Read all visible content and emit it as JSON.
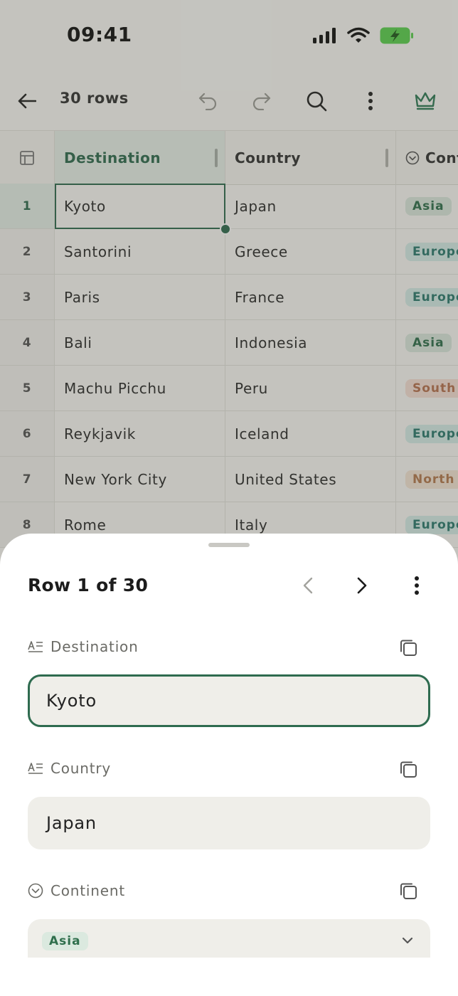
{
  "status_bar": {
    "time": "09:41"
  },
  "toolbar": {
    "title": "30 rows"
  },
  "grid": {
    "columns": [
      "Destination",
      "Country",
      "Cont"
    ],
    "rows": [
      {
        "n": "1",
        "destination": "Kyoto",
        "country": "Japan",
        "continent": "Asia",
        "continent_color": "asia"
      },
      {
        "n": "2",
        "destination": "Santorini",
        "country": "Greece",
        "continent": "Europe",
        "continent_color": "europe"
      },
      {
        "n": "3",
        "destination": "Paris",
        "country": "France",
        "continent": "Europe",
        "continent_color": "europe"
      },
      {
        "n": "4",
        "destination": "Bali",
        "country": "Indonesia",
        "continent": "Asia",
        "continent_color": "asia"
      },
      {
        "n": "5",
        "destination": "Machu Picchu",
        "country": "Peru",
        "continent": "South",
        "continent_color": "south"
      },
      {
        "n": "6",
        "destination": "Reykjavik",
        "country": "Iceland",
        "continent": "Europe",
        "continent_color": "europe"
      },
      {
        "n": "7",
        "destination": "New York City",
        "country": "United States",
        "continent": "North",
        "continent_color": "north"
      },
      {
        "n": "8",
        "destination": "Rome",
        "country": "Italy",
        "continent": "Europe",
        "continent_color": "europe"
      }
    ]
  },
  "sheet": {
    "title": "Row 1 of 30",
    "fields": [
      {
        "label": "Destination",
        "value": "Kyoto"
      },
      {
        "label": "Country",
        "value": "Japan"
      },
      {
        "label": "Continent",
        "value": "Asia"
      }
    ]
  },
  "colors": {
    "accent": "#2e6b4f",
    "asia_bg": "#dbe9df",
    "asia_fg": "#2f6f4c",
    "europe_bg": "#d6ece8",
    "europe_fg": "#2b7a6f",
    "south_bg": "#f6e0d6",
    "south_fg": "#b8714f",
    "north_bg": "#f5e5d6",
    "north_fg": "#b57a4f"
  }
}
